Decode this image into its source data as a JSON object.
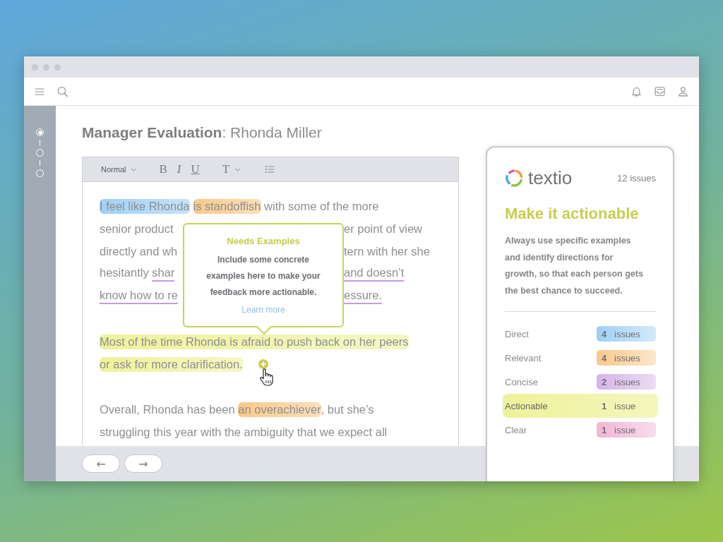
{
  "stepper": [
    {
      "selected": true
    },
    {
      "selected": false
    },
    {
      "selected": false
    }
  ],
  "title": {
    "form": "Manager Evaluation",
    "separator": ":",
    "person": "Rhonda Miller"
  },
  "editor_toolbar": {
    "style": "Normal",
    "formats": [
      {
        "label": "B",
        "kind": "bold"
      },
      {
        "label": "I",
        "kind": "italic"
      },
      {
        "label": "U",
        "kind": "underline"
      }
    ],
    "text_size": "T"
  },
  "paragraphs": [
    {
      "lines": [
        {
          "before": [
            {
              "text": "I feel like Rhonda",
              "kind": "highlight",
              "color": "#9fd0f5"
            },
            {
              "text": "is standoffish",
              "kind": "highlight",
              "color": "#f9c98a"
            },
            {
              "text": " with some of the more",
              "kind": "plain"
            }
          ]
        },
        {
          "before": [
            {
              "text": "senior product",
              "kind": "plain"
            }
          ],
          "after": [
            {
              "text": "er point of view",
              "kind": "plain"
            }
          ]
        },
        {
          "before": [
            {
              "text": "directly and wh",
              "kind": "plain"
            }
          ],
          "after": [
            {
              "text": "tern with her she",
              "kind": "plain"
            }
          ]
        },
        {
          "before": [
            {
              "text": "hesitantly ",
              "kind": "plain"
            },
            {
              "text": "shar",
              "kind": "underline",
              "color": "#c99be0"
            }
          ],
          "after": [
            {
              "text": "and doesn’t",
              "kind": "underline",
              "color": "#c99be0"
            }
          ]
        },
        {
          "before": [
            {
              "text": "know how to re",
              "kind": "underline",
              "color": "#c99be0"
            }
          ],
          "after": [
            {
              "text": "essure.",
              "kind": "underline",
              "color": "#c99be0"
            }
          ]
        }
      ]
    },
    {
      "lines": [
        {
          "before": [
            {
              "text": "Most of the time Rhonda is afraid to push back on her peers",
              "kind": "highlight",
              "color": "#eef29a"
            }
          ]
        },
        {
          "before": [
            {
              "text": "or ask for more clarification.",
              "kind": "highlight",
              "color": "#eef29a"
            }
          ]
        }
      ]
    },
    {
      "lines": [
        {
          "before": [
            {
              "text": "Overall, Rhonda has been ",
              "kind": "plain"
            },
            {
              "text": "an overachiever",
              "kind": "highlight",
              "color": "#f9c98a"
            },
            {
              "text": ", but she’s",
              "kind": "plain"
            }
          ]
        },
        {
          "before": [
            {
              "text": "struggling this year with the ambiguity that we expect all",
              "kind": "plain"
            }
          ]
        }
      ]
    }
  ],
  "tooltip": {
    "title": "Needs Examples",
    "body": "Include some concrete examples here to make your feedback more actionable.",
    "link": "Learn more"
  },
  "nav_buttons": [
    "←",
    "→"
  ],
  "panel": {
    "brand": "textio",
    "issue_total": "12 issues",
    "heading": "Make it actionable",
    "description": "Always use specific examples and identify directions for growth, so that each person gets the best chance to succeed.",
    "categories": [
      {
        "name": "Direct",
        "count": "4",
        "unit": "issues",
        "color": "#9fd0f5",
        "selected": false
      },
      {
        "name": "Relevant",
        "count": "4",
        "unit": "issues",
        "color": "#f9c98a",
        "selected": false
      },
      {
        "name": "Concise",
        "count": "2",
        "unit": "issues",
        "color": "#d6b4e8",
        "selected": false
      },
      {
        "name": "Actionable",
        "count": "1",
        "unit": "issue",
        "color": "#eef29a",
        "selected": true
      },
      {
        "name": "Clear",
        "count": "1",
        "unit": "issue",
        "color": "#f2b5d4",
        "selected": false
      }
    ]
  }
}
